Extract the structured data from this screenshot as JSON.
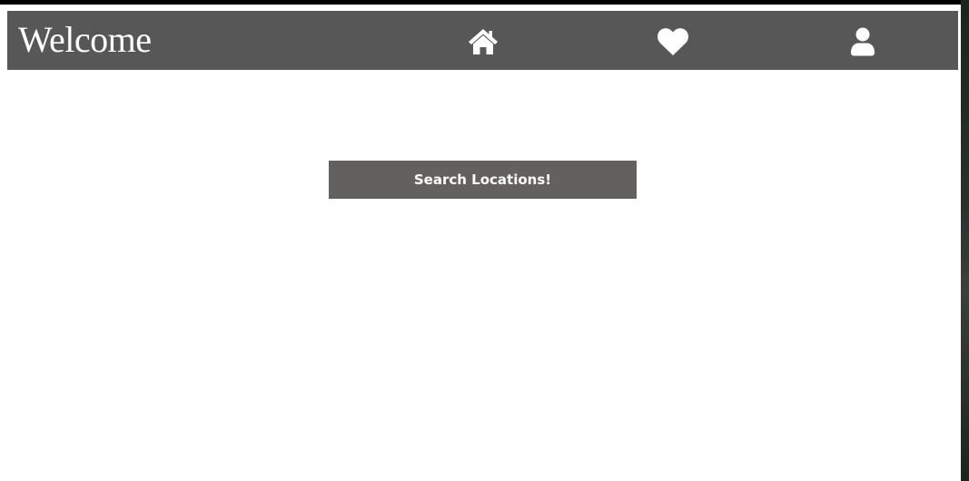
{
  "header": {
    "title": "Welcome",
    "icons": [
      "home-icon",
      "heart-icon",
      "user-icon"
    ]
  },
  "main": {
    "search_button_label": "Search Locations!"
  },
  "colors": {
    "navbar": "#575757",
    "button": "#63615d",
    "text": "#ffffff"
  }
}
